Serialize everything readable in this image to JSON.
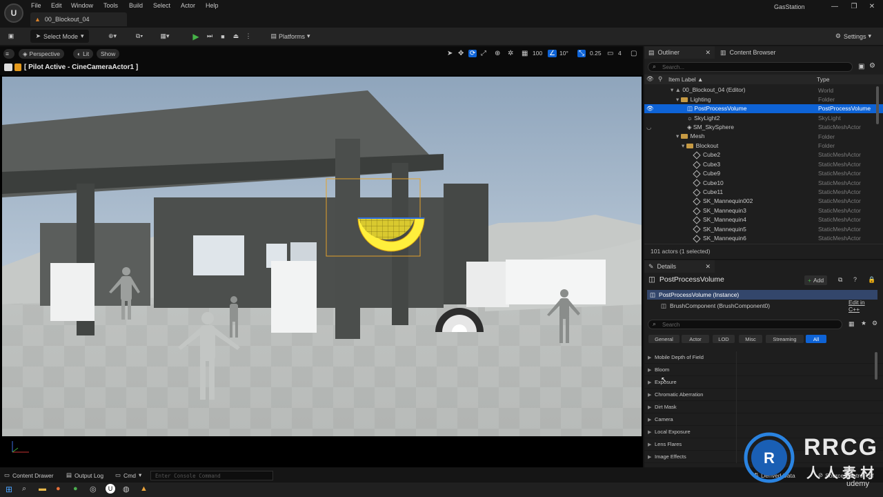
{
  "menubar": {
    "items": [
      "File",
      "Edit",
      "Window",
      "Tools",
      "Build",
      "Select",
      "Actor",
      "Help"
    ],
    "project": "GasStation",
    "doc_tab": "00_Blockout_04"
  },
  "toolbar": {
    "select_mode": "Select Mode",
    "platforms": "Platforms",
    "settings": "Settings"
  },
  "viewport": {
    "perspective": "Perspective",
    "lit": "Lit",
    "show": "Show",
    "pilot_label": "[ Pilot Active - CineCameraActor1 ]",
    "grid_size": "100",
    "rotation_snap": "10°",
    "scale_snap": "0.25",
    "camera_speed": "4"
  },
  "outliner": {
    "tab": "Outliner",
    "tab2": "Content Browser",
    "search_placeholder": "Search...",
    "col_label": "Item Label ▲",
    "col_type": "Type",
    "rows": [
      {
        "label": "00_Blockout_04 (Editor)",
        "type": "World"
      },
      {
        "label": "Lighting",
        "type": "Folder"
      },
      {
        "label": "PostProcessVolume",
        "type": "PostProcessVolume"
      },
      {
        "label": "SkyLight2",
        "type": "SkyLight"
      },
      {
        "label": "SM_SkySphere",
        "type": "StaticMeshActor"
      },
      {
        "label": "Mesh",
        "type": "Folder"
      },
      {
        "label": "Blockout",
        "type": "Folder"
      },
      {
        "label": "Cube2",
        "type": "StaticMeshActor"
      },
      {
        "label": "Cube3",
        "type": "StaticMeshActor"
      },
      {
        "label": "Cube9",
        "type": "StaticMeshActor"
      },
      {
        "label": "Cube10",
        "type": "StaticMeshActor"
      },
      {
        "label": "Cube11",
        "type": "StaticMeshActor"
      },
      {
        "label": "SK_Mannequin002",
        "type": "StaticMeshActor"
      },
      {
        "label": "SK_Mannequin3",
        "type": "StaticMeshActor"
      },
      {
        "label": "SK_Mannequin4",
        "type": "StaticMeshActor"
      },
      {
        "label": "SK_Mannequin5",
        "type": "StaticMeshActor"
      },
      {
        "label": "SK_Mannequin6",
        "type": "StaticMeshActor"
      }
    ],
    "count": "101 actors (1 selected)"
  },
  "details": {
    "tab": "Details",
    "actor_name": "PostProcessVolume",
    "add_label": "Add",
    "instance": "PostProcessVolume (Instance)",
    "component": "BrushComponent (BrushComponent0)",
    "edit_cpp": "Edit in C++",
    "search_placeholder": "Search",
    "filters": [
      "General",
      "Actor",
      "LOD",
      "Misc",
      "Streaming",
      "All"
    ],
    "sections": [
      "Mobile Depth of Field",
      "Bloom",
      "Exposure",
      "Chromatic Aberration",
      "Dirt Mask",
      "Camera",
      "Local Exposure",
      "Lens Flares",
      "Image Effects"
    ]
  },
  "bottom": {
    "content_drawer": "Content Drawer",
    "output_log": "Output Log",
    "cmd": "Cmd",
    "console_placeholder": "Enter Console Command",
    "derived_data": "Derived Data",
    "source_control": "Source Control Off"
  },
  "watermark": {
    "brand": "RRCG",
    "cn": "人人素材",
    "udemy": "udemy"
  },
  "colors": {
    "accent": "#0e63d6",
    "play": "#46b348",
    "folder": "#c69a43"
  }
}
